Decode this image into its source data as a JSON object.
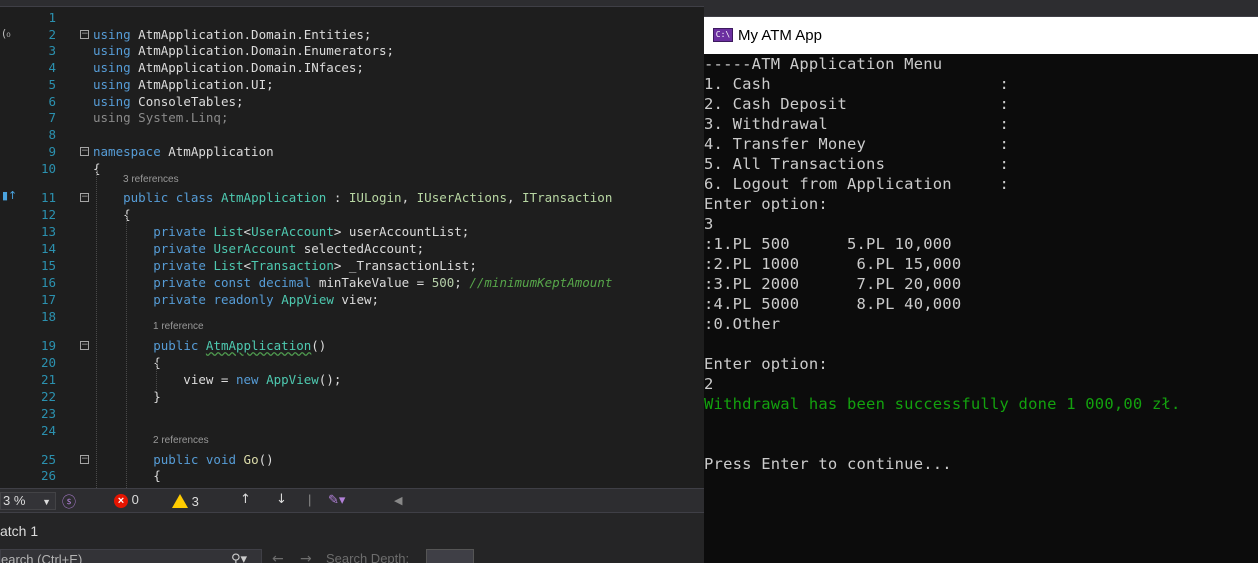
{
  "editor": {
    "lines": [
      {
        "n": "1",
        "html": ""
      },
      {
        "n": "2",
        "fold": "−",
        "html": "<span class='kw'>using</span> AtmApplication.Domain.Entities;"
      },
      {
        "n": "3",
        "html": "<span class='kw'>using</span> AtmApplication.Domain.Enumerators;"
      },
      {
        "n": "4",
        "html": "<span class='kw'>using</span> AtmApplication.Domain.INfaces;"
      },
      {
        "n": "5",
        "html": "<span class='kw'>using</span> AtmApplication.UI;"
      },
      {
        "n": "6",
        "html": "<span class='kw'>using</span> ConsoleTables;"
      },
      {
        "n": "7",
        "html": "<span class='kw dim'>using</span><span class='dim'> System.Linq;</span>"
      },
      {
        "n": "8",
        "html": ""
      },
      {
        "n": "9",
        "fold": "−",
        "html": "<span class='kw'>namespace</span> AtmApplication"
      },
      {
        "n": "10",
        "html": "{"
      },
      {
        "n": "11",
        "fold": "−",
        "html": "    <span class='kw'>public</span> <span class='kw'>class</span> <span class='ty'>AtmApplication</span> : <span class='it'>IULogin</span>, <span class='it'>IUserActions</span>, <span class='it'>ITransaction</span>"
      },
      {
        "n": "12",
        "html": "    {"
      },
      {
        "n": "13",
        "html": "        <span class='kw'>private</span> <span class='ty'>List</span>&lt;<span class='ty'>UserAccount</span>&gt; userAccountList;"
      },
      {
        "n": "14",
        "html": "        <span class='kw'>private</span> <span class='ty'>UserAccount</span> selectedAccount;"
      },
      {
        "n": "15",
        "html": "        <span class='kw'>private</span> <span class='ty'>List</span>&lt;<span class='ty'>Transaction</span>&gt; _TransactionList;"
      },
      {
        "n": "16",
        "html": "        <span class='kw'>private</span> <span class='kw'>const</span> <span class='kw'>decimal</span> minTakeValue = <span class='num'>500</span>; <span class='cm'>//minimumKeptAmount</span>"
      },
      {
        "n": "17",
        "html": "        <span class='kw'>private</span> <span class='kw'>readonly</span> <span class='ty'>AppView</span> view;"
      },
      {
        "n": "18",
        "html": ""
      },
      {
        "n": "19",
        "fold": "−",
        "html": "        <span class='kw'>public</span> <span class='ty squig'>AtmApplication</span>()"
      },
      {
        "n": "20",
        "html": "        {"
      },
      {
        "n": "21",
        "html": "            view = <span class='kw'>new</span> <span class='ty'>AppView</span>();"
      },
      {
        "n": "22",
        "html": "        }"
      },
      {
        "n": "23",
        "html": ""
      },
      {
        "n": "24",
        "html": ""
      },
      {
        "n": "25",
        "fold": "−",
        "html": "        <span class='kw'>public</span> <span class='kw'>void</span> <span class='mt'>Go</span>()"
      },
      {
        "n": "26",
        "html": "        {"
      }
    ],
    "refs": {
      "r11": "3 references",
      "r19": "1 reference",
      "r25": "2 references"
    }
  },
  "status": {
    "zoom": "3 %",
    "errors": "0",
    "warnings": "3"
  },
  "watch": {
    "title": "atch 1",
    "search_placeholder": "earch (Ctrl+E)",
    "search_depth_label": "Search Depth:"
  },
  "console": {
    "title": "My ATM App",
    "icon_label": "C:\\",
    "lines": [
      "-----ATM Application Menu",
      "1. Cash                        :",
      "2. Cash Deposit                :",
      "3. Withdrawal                  :",
      "4. Transfer Money              :",
      "5. All Transactions            :",
      "6. Logout from Application     :",
      "Enter option:",
      "3",
      ":1.PL 500      5.PL 10,000",
      ":2.PL 1000      6.PL 15,000",
      ":3.PL 2000      7.PL 20,000",
      ":4.PL 5000      8.PL 40,000",
      ":0.Other",
      "",
      "Enter option:",
      "2",
      "Withdrawal has been successfully done 1 000,00 zł.",
      "",
      "",
      "Press Enter to continue..."
    ],
    "success_line_index": 17,
    "success_color": "#13a10e"
  }
}
